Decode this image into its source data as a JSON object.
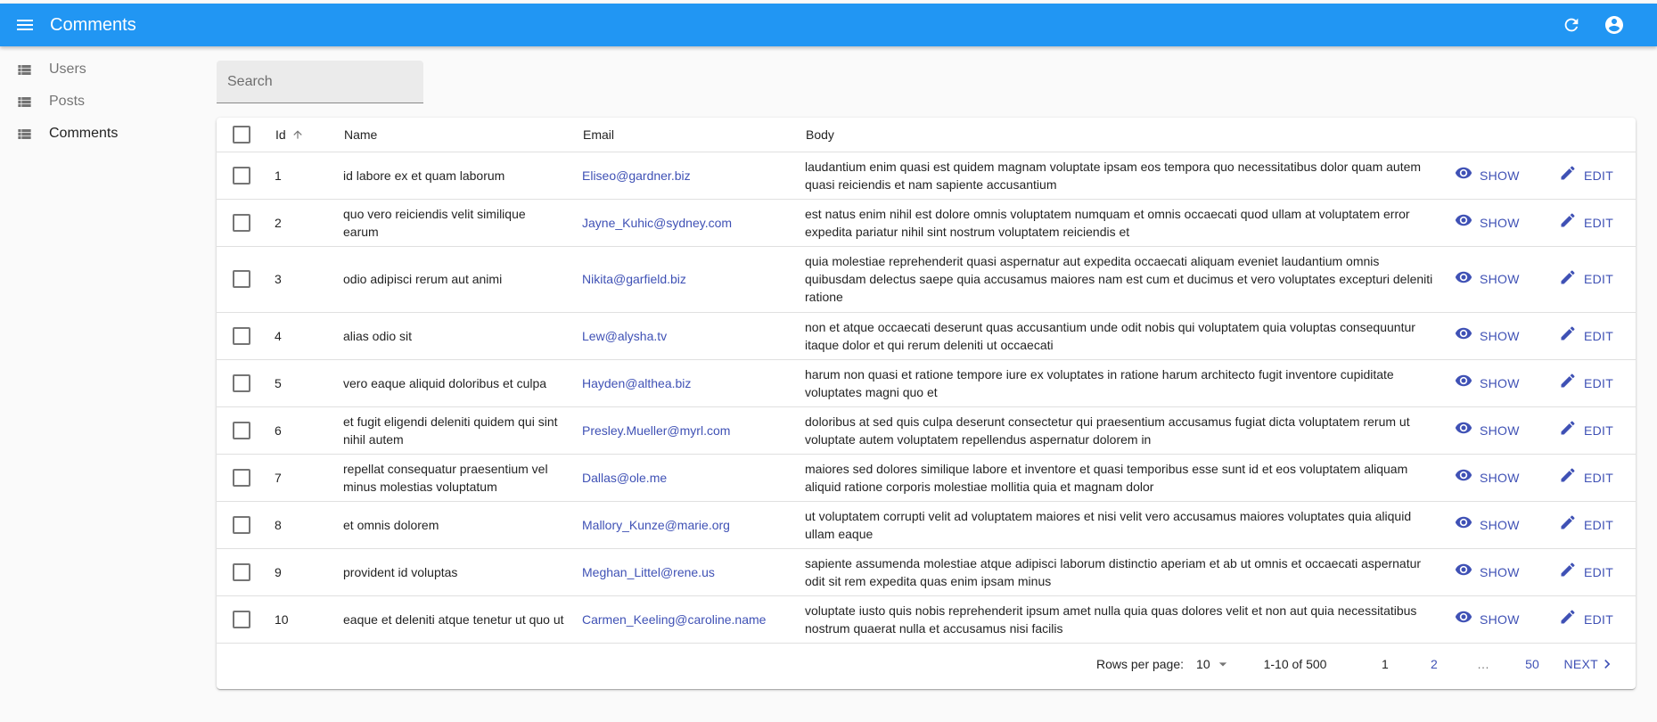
{
  "appbar": {
    "title": "Comments",
    "menu_icon": "menu-icon",
    "refresh_icon": "refresh-icon",
    "account_icon": "account-circle-icon",
    "color": "#2196f3"
  },
  "sidebar": {
    "items": [
      {
        "label": "Users",
        "icon": "list-icon",
        "active": false
      },
      {
        "label": "Posts",
        "icon": "list-icon",
        "active": false
      },
      {
        "label": "Comments",
        "icon": "list-icon",
        "active": true
      }
    ]
  },
  "search": {
    "placeholder": "Search",
    "value": ""
  },
  "table": {
    "columns": [
      "Id",
      "Name",
      "Email",
      "Body"
    ],
    "sorted_column": "Id",
    "sort_direction": "ascending",
    "show_label": "SHOW",
    "edit_label": "EDIT",
    "rows": [
      {
        "id": "1",
        "name": "id labore ex et quam laborum",
        "email": "Eliseo@gardner.biz",
        "body": "laudantium enim quasi est quidem magnam voluptate ipsam eos tempora quo necessitatibus dolor quam autem quasi reiciendis et nam sapiente accusantium"
      },
      {
        "id": "2",
        "name": "quo vero reiciendis velit similique earum",
        "email": "Jayne_Kuhic@sydney.com",
        "body": "est natus enim nihil est dolore omnis voluptatem numquam et omnis occaecati quod ullam at voluptatem error expedita pariatur nihil sint nostrum voluptatem reiciendis et"
      },
      {
        "id": "3",
        "name": "odio adipisci rerum aut animi",
        "email": "Nikita@garfield.biz",
        "body": "quia molestiae reprehenderit quasi aspernatur aut expedita occaecati aliquam eveniet laudantium omnis quibusdam delectus saepe quia accusamus maiores nam est cum et ducimus et vero voluptates excepturi deleniti ratione"
      },
      {
        "id": "4",
        "name": "alias odio sit",
        "email": "Lew@alysha.tv",
        "body": "non et atque occaecati deserunt quas accusantium unde odit nobis qui voluptatem quia voluptas consequuntur itaque dolor et qui rerum deleniti ut occaecati"
      },
      {
        "id": "5",
        "name": "vero eaque aliquid doloribus et culpa",
        "email": "Hayden@althea.biz",
        "body": "harum non quasi et ratione tempore iure ex voluptates in ratione harum architecto fugit inventore cupiditate voluptates magni quo et"
      },
      {
        "id": "6",
        "name": "et fugit eligendi deleniti quidem qui sint nihil autem",
        "email": "Presley.Mueller@myrl.com",
        "body": "doloribus at sed quis culpa deserunt consectetur qui praesentium accusamus fugiat dicta voluptatem rerum ut voluptate autem voluptatem repellendus aspernatur dolorem in"
      },
      {
        "id": "7",
        "name": "repellat consequatur praesentium vel minus molestias voluptatum",
        "email": "Dallas@ole.me",
        "body": "maiores sed dolores similique labore et inventore et quasi temporibus esse sunt id et eos voluptatem aliquam aliquid ratione corporis molestiae mollitia quia et magnam dolor"
      },
      {
        "id": "8",
        "name": "et omnis dolorem",
        "email": "Mallory_Kunze@marie.org",
        "body": "ut voluptatem corrupti velit ad voluptatem maiores et nisi velit vero accusamus maiores voluptates quia aliquid ullam eaque"
      },
      {
        "id": "9",
        "name": "provident id voluptas",
        "email": "Meghan_Littel@rene.us",
        "body": "sapiente assumenda molestiae atque adipisci laborum distinctio aperiam et ab ut omnis et occaecati aspernatur odit sit rem expedita quas enim ipsam minus"
      },
      {
        "id": "10",
        "name": "eaque et deleniti atque tenetur ut quo ut",
        "email": "Carmen_Keeling@caroline.name",
        "body": "voluptate iusto quis nobis reprehenderit ipsum amet nulla quia quas dolores velit et non aut quia necessitatibus nostrum quaerat nulla et accusamus nisi facilis"
      }
    ]
  },
  "pagination": {
    "rows_per_page_label": "Rows per page:",
    "rows_per_page": "10",
    "range": "1-10 of 500",
    "pages": [
      "1",
      "2",
      "…",
      "50"
    ],
    "current_page": "1",
    "next_label": "NEXT"
  }
}
